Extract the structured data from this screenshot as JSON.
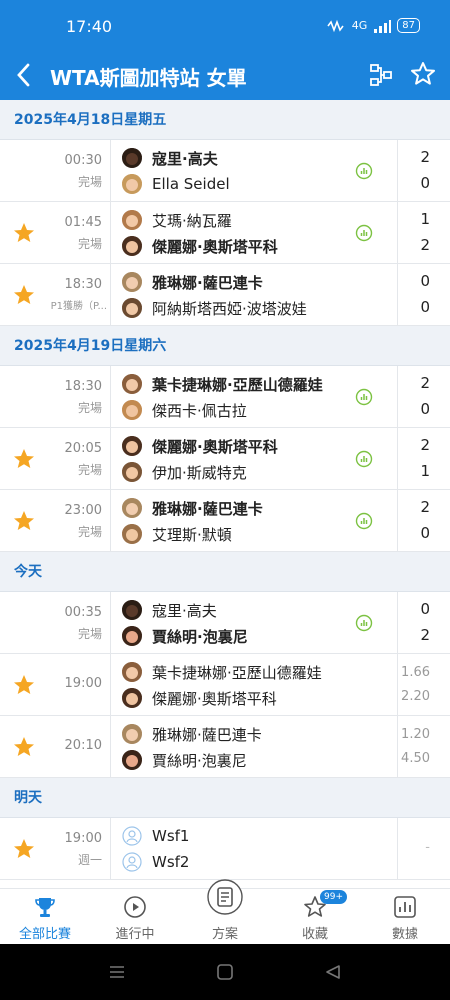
{
  "status_bar": {
    "time": "17:40",
    "network": "4G",
    "battery": "87"
  },
  "header": {
    "title": "WTA斯圖加特站 女單",
    "back_icon": "back-chevron-icon",
    "bracket_icon": "bracket-icon",
    "favorite_icon": "star-outline-icon"
  },
  "colors": {
    "primary": "#1c84dc",
    "star": "#f5a623",
    "stats_green": "#7cc242"
  },
  "sections": [
    {
      "date": "2025年4月18日星期五",
      "matches": [
        {
          "starred": false,
          "time": "00:30",
          "status": "完場",
          "stats": true,
          "p1": {
            "name": "寇里·高夫",
            "bold": true,
            "hair": "#2b1d14",
            "skin": "#5a3a2a"
          },
          "p2": {
            "name": "Ella Seidel",
            "bold": false,
            "hair": "#c79a5c",
            "skin": "#f1c9a8"
          },
          "s1": "2",
          "s2": "0",
          "odds": false
        },
        {
          "starred": true,
          "time": "01:45",
          "status": "完場",
          "stats": true,
          "p1": {
            "name": "艾瑪·納瓦羅",
            "bold": false,
            "hair": "#b27a4a",
            "skin": "#f3c9a6"
          },
          "p2": {
            "name": "傑麗娜·奧斯塔平科",
            "bold": true,
            "hair": "#4a2e1e",
            "skin": "#efc3a0"
          },
          "s1": "1",
          "s2": "2",
          "odds": false
        },
        {
          "starred": true,
          "time": "18:30",
          "status": "P1獲勝（P...",
          "stats": false,
          "p1": {
            "name": "雅琳娜·薩巴連卡",
            "bold": true,
            "hair": "#a8875f",
            "skin": "#f1cdb0"
          },
          "p2": {
            "name": "阿納斯塔西婭·波塔波娃",
            "bold": false,
            "hair": "#6b4a30",
            "skin": "#f0c8a6"
          },
          "s1": "0",
          "s2": "0",
          "odds": false
        }
      ]
    },
    {
      "date": "2025年4月19日星期六",
      "matches": [
        {
          "starred": false,
          "time": "18:30",
          "status": "完場",
          "stats": true,
          "p1": {
            "name": "葉卡捷琳娜·亞歷山德羅娃",
            "bold": true,
            "hair": "#8a5e3c",
            "skin": "#f2c9a8"
          },
          "p2": {
            "name": "傑西卡·佩古拉",
            "bold": false,
            "hair": "#c28a50",
            "skin": "#f0c5a0"
          },
          "s1": "2",
          "s2": "0",
          "odds": false
        },
        {
          "starred": true,
          "time": "20:05",
          "status": "完場",
          "stats": true,
          "p1": {
            "name": "傑麗娜·奧斯塔平科",
            "bold": true,
            "hair": "#4a2e1e",
            "skin": "#efc3a0"
          },
          "p2": {
            "name": "伊加·斯威特克",
            "bold": false,
            "hair": "#7a5536",
            "skin": "#f1c7a3"
          },
          "s1": "2",
          "s2": "1",
          "odds": false
        },
        {
          "starred": true,
          "time": "23:00",
          "status": "完場",
          "stats": true,
          "p1": {
            "name": "雅琳娜·薩巴連卡",
            "bold": true,
            "hair": "#a8875f",
            "skin": "#f1cdb0"
          },
          "p2": {
            "name": "艾理斯·默頓",
            "bold": false,
            "hair": "#9a7048",
            "skin": "#f0c8a2"
          },
          "s1": "2",
          "s2": "0",
          "odds": false
        }
      ]
    },
    {
      "date": "今天",
      "matches": [
        {
          "starred": false,
          "time": "00:35",
          "status": "完場",
          "stats": true,
          "p1": {
            "name": "寇里·高夫",
            "bold": false,
            "hair": "#2b1d14",
            "skin": "#5a3a2a"
          },
          "p2": {
            "name": "賈絲明·泡裏尼",
            "bold": true,
            "hair": "#3a2418",
            "skin": "#e8a88a"
          },
          "s1": "0",
          "s2": "2",
          "odds": false
        },
        {
          "starred": true,
          "time": "19:00",
          "status": "",
          "stats": false,
          "p1": {
            "name": "葉卡捷琳娜·亞歷山德羅娃",
            "bold": false,
            "hair": "#8a5e3c",
            "skin": "#f2c9a8"
          },
          "p2": {
            "name": "傑麗娜·奧斯塔平科",
            "bold": false,
            "hair": "#4a2e1e",
            "skin": "#efc3a0"
          },
          "s1": "1.66",
          "s2": "2.20",
          "odds": true
        },
        {
          "starred": true,
          "time": "20:10",
          "status": "",
          "stats": false,
          "p1": {
            "name": "雅琳娜·薩巴連卡",
            "bold": false,
            "hair": "#a8875f",
            "skin": "#f1cdb0"
          },
          "p2": {
            "name": "賈絲明·泡裏尼",
            "bold": false,
            "hair": "#3a2418",
            "skin": "#e8a88a"
          },
          "s1": "1.20",
          "s2": "4.50",
          "odds": true
        }
      ]
    },
    {
      "date": "明天",
      "matches": [
        {
          "starred": true,
          "time": "19:00",
          "status": "週一",
          "stats": false,
          "placeholder": true,
          "p1": {
            "name": "Wsf1",
            "bold": false
          },
          "p2": {
            "name": "Wsf2",
            "bold": false
          },
          "s1": "-",
          "s2": "",
          "odds": false
        }
      ]
    }
  ],
  "tabs": [
    {
      "label": "全部比賽",
      "icon": "trophy-icon",
      "active": true
    },
    {
      "label": "進行中",
      "icon": "play-circle-icon",
      "active": false
    },
    {
      "label": "方案",
      "icon": "document-icon",
      "active": false
    },
    {
      "label": "收藏",
      "icon": "star-outline-icon",
      "active": false,
      "badge": "99+"
    },
    {
      "label": "數據",
      "icon": "chart-icon",
      "active": false
    }
  ]
}
